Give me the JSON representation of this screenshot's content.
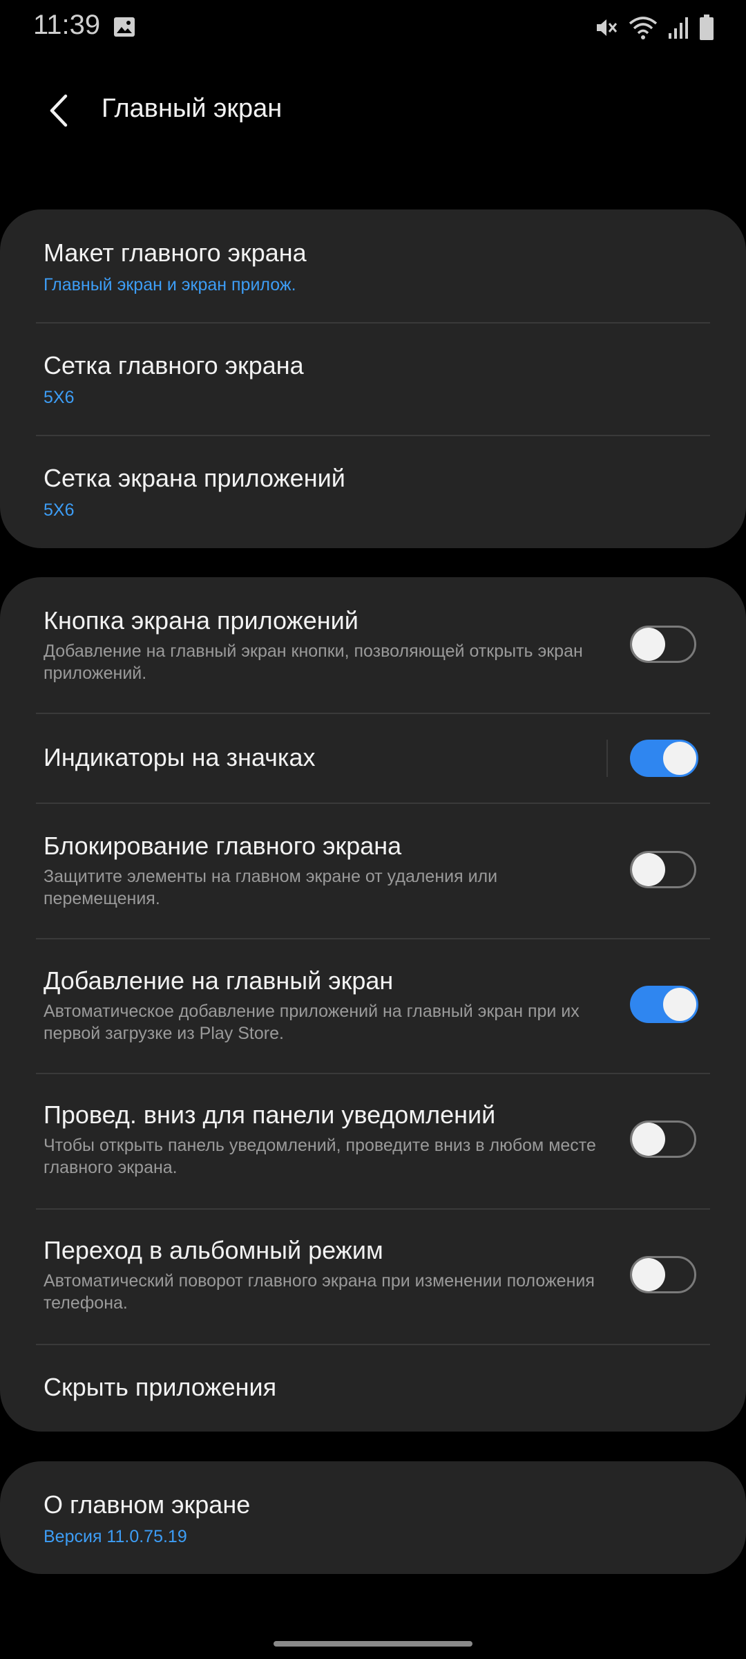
{
  "status_bar": {
    "time": "11:39",
    "icons": [
      "image-icon",
      "mute-icon",
      "wifi-icon",
      "signal-icon",
      "battery-icon"
    ]
  },
  "header": {
    "title": "Главный экран",
    "back_icon": "chevron-left-icon"
  },
  "layout_section": [
    {
      "title": "Макет главного экрана",
      "value": "Главный экран и экран прилож."
    },
    {
      "title": "Сетка главного экрана",
      "value": "5X6"
    },
    {
      "title": "Сетка экрана приложений",
      "value": "5X6"
    }
  ],
  "toggle_section": [
    {
      "title": "Кнопка экрана приложений",
      "desc": "Добавление на главный экран кнопки, позволяющей открыть экран приложений.",
      "on": false
    },
    {
      "title": "Индикаторы на значках",
      "desc": "",
      "on": true
    },
    {
      "title": "Блокирование главного экрана",
      "desc": "Защитите элементы на главном экране от удаления или перемещения.",
      "on": false
    },
    {
      "title": "Добавление на главный экран",
      "desc": "Автоматическое добавление приложений на главный экран при их первой загрузке из Play Store.",
      "on": true
    },
    {
      "title": "Провед. вниз для панели уведомлений",
      "desc": "Чтобы открыть панель уведомлений, проведите вниз в любом месте главного экрана.",
      "on": false
    },
    {
      "title": "Переход в альбомный режим",
      "desc": "Автоматический поворот главного экрана при изменении положения телефона.",
      "on": false
    },
    {
      "title": "Скрыть приложения"
    }
  ],
  "about_section": {
    "title": "О главном экране",
    "version": "Версия 11.0.75.19"
  },
  "colors": {
    "background": "#000000",
    "card": "#252525",
    "accent": "#2f86f0",
    "link": "#3d9df5"
  }
}
